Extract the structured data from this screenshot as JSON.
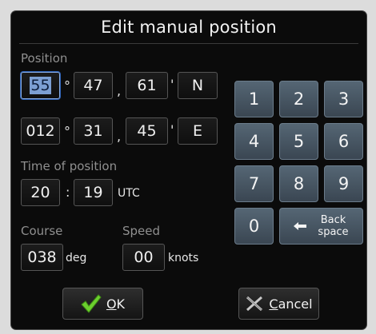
{
  "dialog": {
    "title": "Edit manual position"
  },
  "position": {
    "label": "Position",
    "lat": {
      "deg_selected": "55",
      "min": "47",
      "sec": "61",
      "hemisphere": "N"
    },
    "lon": {
      "deg": "012",
      "min": "31",
      "sec": "45",
      "hemisphere": "E"
    },
    "symbols": {
      "degree": "°",
      "comma": ",",
      "prime": "'"
    }
  },
  "time": {
    "label": "Time of position",
    "hour": "20",
    "minute": "19",
    "colon": ":",
    "zone": "UTC"
  },
  "course": {
    "label": "Course",
    "value": "038",
    "unit": "deg"
  },
  "speed": {
    "label": "Speed",
    "value": "00",
    "unit": "knots"
  },
  "keypad": {
    "keys": [
      "1",
      "2",
      "3",
      "4",
      "5",
      "6",
      "7",
      "8",
      "9",
      "0"
    ],
    "backspace_line1": "Back",
    "backspace_line2": "space",
    "backspace_icon": "left-arrow-icon"
  },
  "buttons": {
    "ok_mnemonic": "O",
    "ok_rest": "K",
    "ok_icon": "checkmark-icon",
    "cancel_mnemonic": "C",
    "cancel_rest": "ancel",
    "cancel_icon": "x-cross-icon"
  },
  "colors": {
    "keypad": "#4a5864",
    "selection": "#7c9fd3",
    "ok_check": "#6bcf2e"
  }
}
